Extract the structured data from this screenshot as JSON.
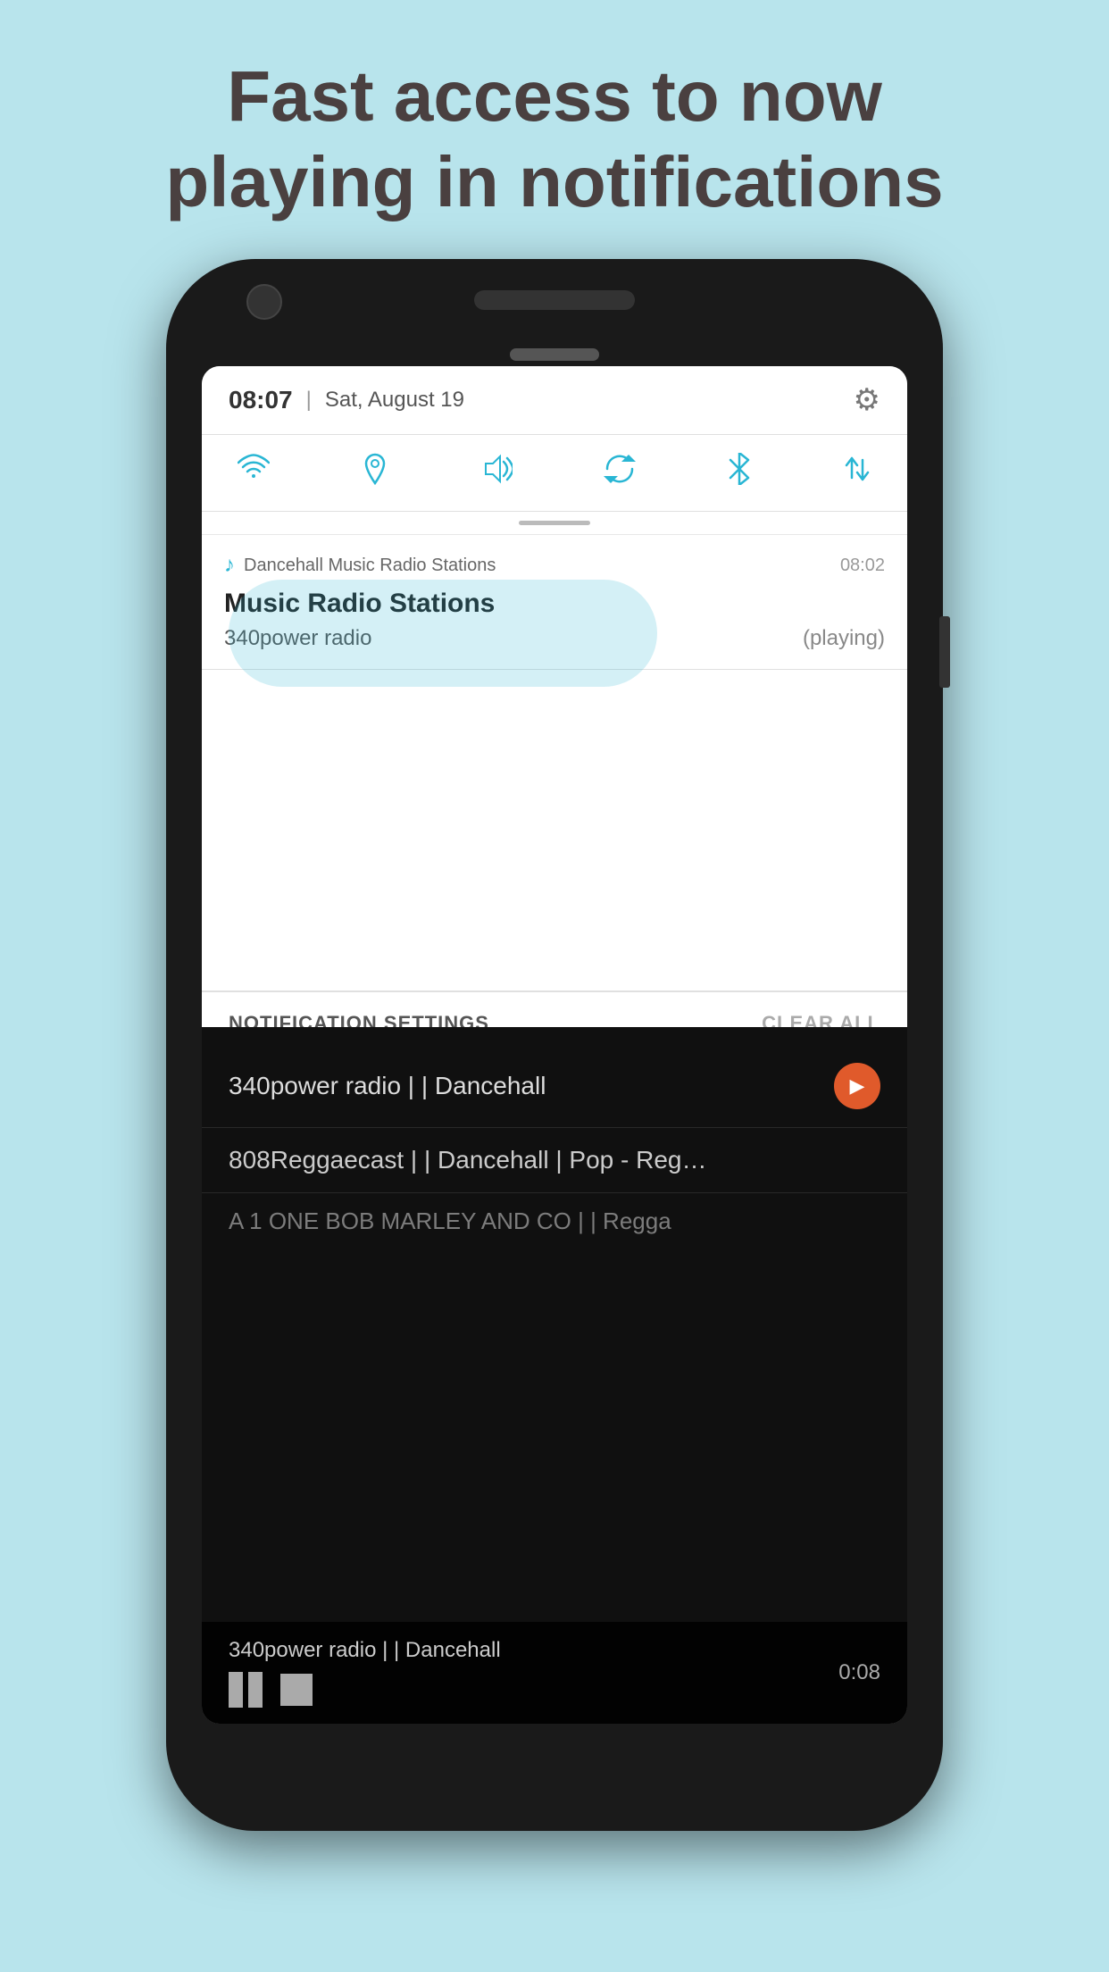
{
  "header": {
    "title_line1": "Fast access to now",
    "title_line2": "playing in notifications"
  },
  "phone": {
    "status_bar": {
      "time": "08:07",
      "divider": "|",
      "date": "Sat, August 19",
      "gear_icon": "⚙"
    },
    "quick_settings": {
      "icons": [
        {
          "name": "wifi",
          "symbol": "📶",
          "unicode": ""
        },
        {
          "name": "location",
          "symbol": "📍",
          "unicode": ""
        },
        {
          "name": "volume",
          "symbol": "🔊",
          "unicode": ""
        },
        {
          "name": "sync",
          "symbol": "🔄",
          "unicode": ""
        },
        {
          "name": "bluetooth",
          "symbol": "⚡",
          "unicode": ""
        },
        {
          "name": "data-transfer",
          "symbol": "⇅",
          "unicode": ""
        }
      ]
    },
    "notification": {
      "app_icon": "♪",
      "app_name": "Dancehall Music Radio Stations",
      "time": "08:02",
      "title": "Music Radio Stations",
      "station": "340power radio",
      "status": "(playing)"
    },
    "bottom_bar": {
      "settings_label": "NOTIFICATION SETTINGS",
      "clear_label": "CLEAR ALL"
    },
    "app": {
      "radio_items": [
        {
          "label": "340power radio | | Dancehall",
          "has_play": true
        },
        {
          "label": "808Reggaecast | | Dancehall | Pop - Reg…",
          "has_play": false
        },
        {
          "label": "A 1 ONE BOB MARLEY AND CO | | Regga",
          "has_play": false
        }
      ],
      "bottom_station": "340power radio | | Dancehall",
      "player_time": "0:08"
    }
  }
}
